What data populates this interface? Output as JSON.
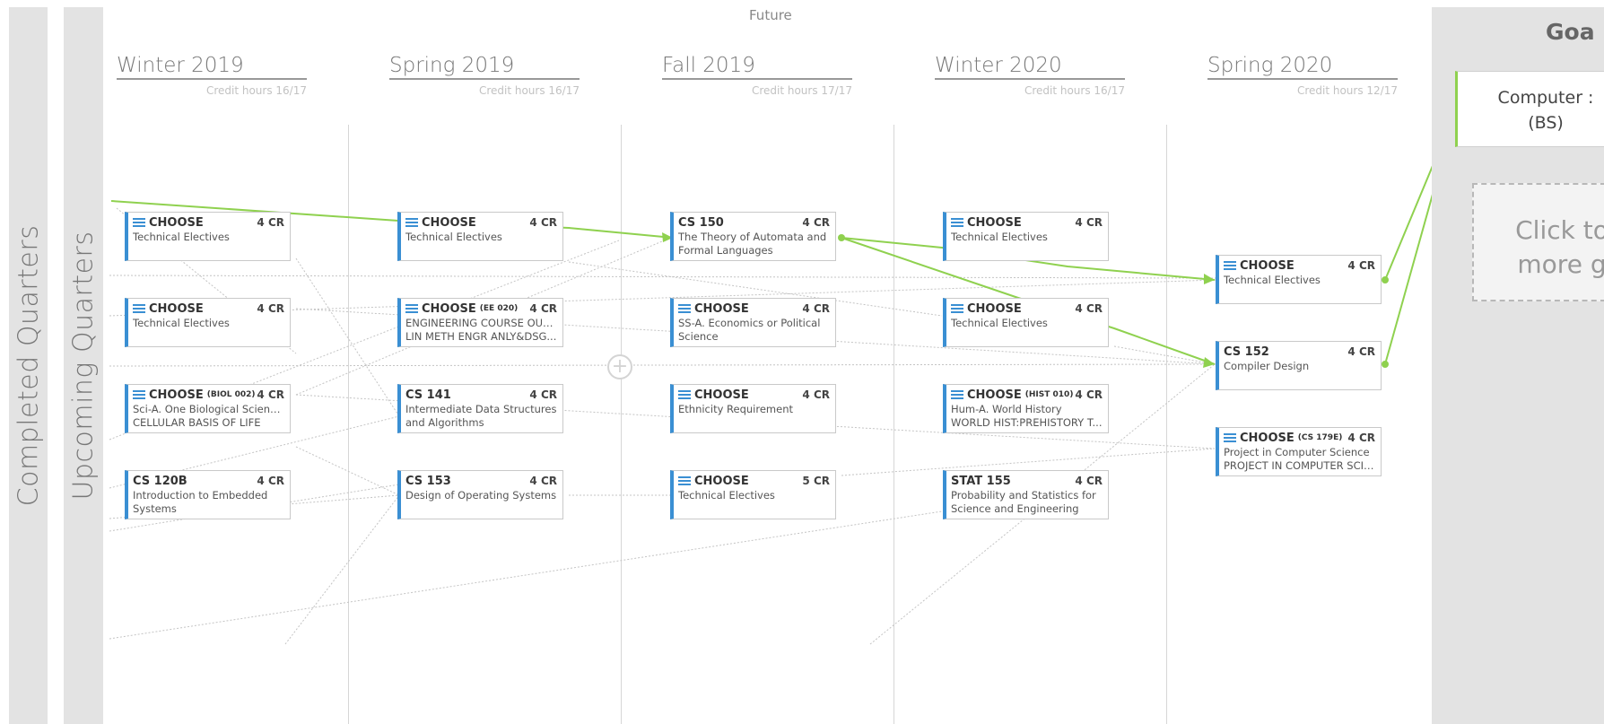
{
  "sidebar": {
    "completed_label": "Completed Quarters",
    "upcoming_label": "Upcoming Quarters"
  },
  "future_label": "Future",
  "quarters": [
    {
      "title": "Winter 2019",
      "credits": "Credit hours 16/17"
    },
    {
      "title": "Spring 2019",
      "credits": "Credit hours 16/17"
    },
    {
      "title": "Fall 2019",
      "credits": "Credit hours 17/17"
    },
    {
      "title": "Winter 2020",
      "credits": "Credit hours 16/17"
    },
    {
      "title": "Spring 2020",
      "credits": "Credit hours 12/17"
    }
  ],
  "courses": [
    {
      "code": "CHOOSE",
      "sub": "",
      "credits": "4 CR",
      "line1": "Technical Electives",
      "line2": ""
    },
    {
      "code": "CHOOSE",
      "sub": "",
      "credits": "4 CR",
      "line1": "Technical Electives",
      "line2": ""
    },
    {
      "code": "CHOOSE",
      "sub": "(BIOL 002)",
      "credits": "4 CR",
      "line1": "Sci-A. One Biological Sciences",
      "line2": "CELLULAR BASIS OF LIFE"
    },
    {
      "code": "CS 120B",
      "sub": "",
      "credits": "4 CR",
      "line1": "Introduction to Embedded",
      "line2": "Systems"
    },
    {
      "code": "CHOOSE",
      "sub": "",
      "credits": "4 CR",
      "line1": "Technical Electives",
      "line2": ""
    },
    {
      "code": "CHOOSE",
      "sub": "(EE 020)",
      "credits": "4 CR",
      "line1": "ENGINEERING COURSE OUT...",
      "line2": "LIN METH ENGR ANLY&DSG..."
    },
    {
      "code": "CS 141",
      "sub": "",
      "credits": "4 CR",
      "line1": "Intermediate Data Structures",
      "line2": "and Algorithms"
    },
    {
      "code": "CS 153",
      "sub": "",
      "credits": "4 CR",
      "line1": "Design of Operating Systems",
      "line2": ""
    },
    {
      "code": "CS 150",
      "sub": "",
      "credits": "4 CR",
      "line1": "The Theory of Automata and",
      "line2": "Formal Languages"
    },
    {
      "code": "CHOOSE",
      "sub": "",
      "credits": "4 CR",
      "line1": "SS-A. Economics or Political",
      "line2": "Science"
    },
    {
      "code": "CHOOSE",
      "sub": "",
      "credits": "4 CR",
      "line1": "Ethnicity Requirement",
      "line2": ""
    },
    {
      "code": "CHOOSE",
      "sub": "",
      "credits": "5 CR",
      "line1": "Technical Electives",
      "line2": ""
    },
    {
      "code": "CHOOSE",
      "sub": "",
      "credits": "4 CR",
      "line1": "Technical Electives",
      "line2": ""
    },
    {
      "code": "CHOOSE",
      "sub": "",
      "credits": "4 CR",
      "line1": "Technical Electives",
      "line2": ""
    },
    {
      "code": "CHOOSE",
      "sub": "(HIST 010)",
      "credits": "4 CR",
      "line1": "Hum-A. World History",
      "line2": "WORLD HIST:PREHISTORY T..."
    },
    {
      "code": "STAT 155",
      "sub": "",
      "credits": "4 CR",
      "line1": "Probability and Statistics for",
      "line2": "Science and Engineering"
    },
    {
      "code": "CHOOSE",
      "sub": "",
      "credits": "4 CR",
      "line1": "Technical Electives",
      "line2": ""
    },
    {
      "code": "CS 152",
      "sub": "",
      "credits": "4 CR",
      "line1": "Compiler Design",
      "line2": ""
    },
    {
      "code": "CHOOSE",
      "sub": "(CS 179E)",
      "credits": "4 CR",
      "line1": "Project in Computer Science",
      "line2": "PROJECT IN COMPUTER SCIE..."
    }
  ],
  "add_course_symbol": "+",
  "goals": {
    "title": "Goa",
    "goal_line1": "Computer :",
    "goal_line2": "(BS)",
    "add_line1": "Click to",
    "add_line2": "more g"
  },
  "colors": {
    "accent_blue": "#3a8fd3",
    "path_green": "#8fd14f",
    "panel_gray": "#e3e3e3"
  }
}
